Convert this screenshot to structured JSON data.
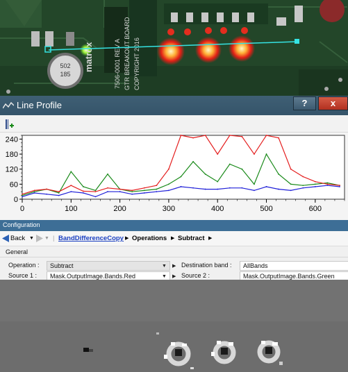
{
  "line_profile": {
    "title": "Line Profile",
    "help_label": "?",
    "close_label": "x",
    "y_ticks": [
      "240",
      "180",
      "120",
      "60",
      "0"
    ],
    "x_ticks": [
      "0",
      "100",
      "200",
      "300",
      "400",
      "500",
      "600"
    ],
    "series_colors": {
      "red": "#e41e1e",
      "green": "#1a8a1a",
      "blue": "#1f1fd8"
    }
  },
  "chart_data": {
    "type": "line",
    "x": [
      0,
      25,
      50,
      75,
      100,
      125,
      150,
      175,
      200,
      225,
      250,
      275,
      300,
      325,
      350,
      375,
      400,
      425,
      450,
      475,
      500,
      525,
      550,
      575,
      600,
      625,
      650
    ],
    "series": [
      {
        "name": "",
        "values": [
          20,
          35,
          40,
          30,
          55,
          32,
          30,
          45,
          40,
          35,
          45,
          55,
          120,
          255,
          245,
          255,
          180,
          255,
          250,
          180,
          255,
          245,
          120,
          90,
          70,
          60,
          55
        ]
      },
      {
        "name": "",
        "values": [
          15,
          30,
          40,
          25,
          110,
          50,
          35,
          100,
          40,
          30,
          35,
          40,
          60,
          90,
          150,
          100,
          70,
          140,
          120,
          60,
          180,
          100,
          60,
          55,
          60,
          65,
          55
        ]
      },
      {
        "name": "",
        "values": [
          10,
          25,
          20,
          15,
          30,
          25,
          10,
          30,
          30,
          20,
          25,
          30,
          35,
          50,
          45,
          40,
          40,
          45,
          45,
          35,
          50,
          40,
          35,
          45,
          50,
          55,
          50
        ]
      }
    ],
    "xlim": [
      0,
      660
    ],
    "ylim": [
      0,
      255
    ]
  },
  "configuration": {
    "title": "Configuration",
    "nav": {
      "back_label": "Back",
      "crumbs": [
        "BandDifferenceCopy",
        "Operations",
        "Subtract"
      ]
    },
    "section_label": "General",
    "operation_label": "Operation :",
    "operation_value": "Subtract",
    "destination_label": "Destination band :",
    "destination_value": "AllBands",
    "source1_label": "Source 1 :",
    "source1_value": "Mask.OutputImage.Bands.Red",
    "source2_label": "Source 2 :",
    "source2_value": "Mask.OutputImage.Bands.Green"
  }
}
